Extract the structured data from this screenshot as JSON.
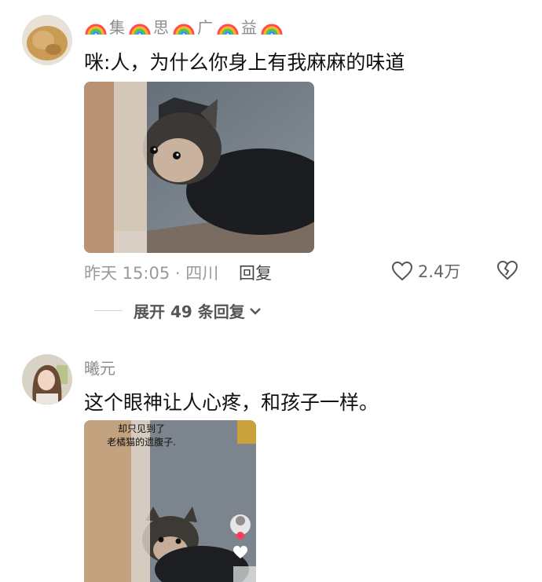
{
  "comments": [
    {
      "username_chars": [
        "集",
        "思",
        "广",
        "益"
      ],
      "text": "咪:人，为什么你身上有我麻麻的味道",
      "time_location": "昨天 15:05 · 四川",
      "reply_label": "回复",
      "likes": "2.4万",
      "expand_label": "展开 49 条回复"
    },
    {
      "username": "曦元",
      "text": "这个眼神让人心疼，和孩子一样。",
      "image_overlay_line1": "却只见到了",
      "image_overlay_line2": "老橘猫的遗腹子."
    }
  ],
  "colors": {
    "meta_gray": "#9a9a9a",
    "text": "#111111"
  },
  "icons": [
    "rainbow-icon",
    "heart-outline-icon",
    "broken-heart-icon",
    "chevron-down-icon"
  ]
}
